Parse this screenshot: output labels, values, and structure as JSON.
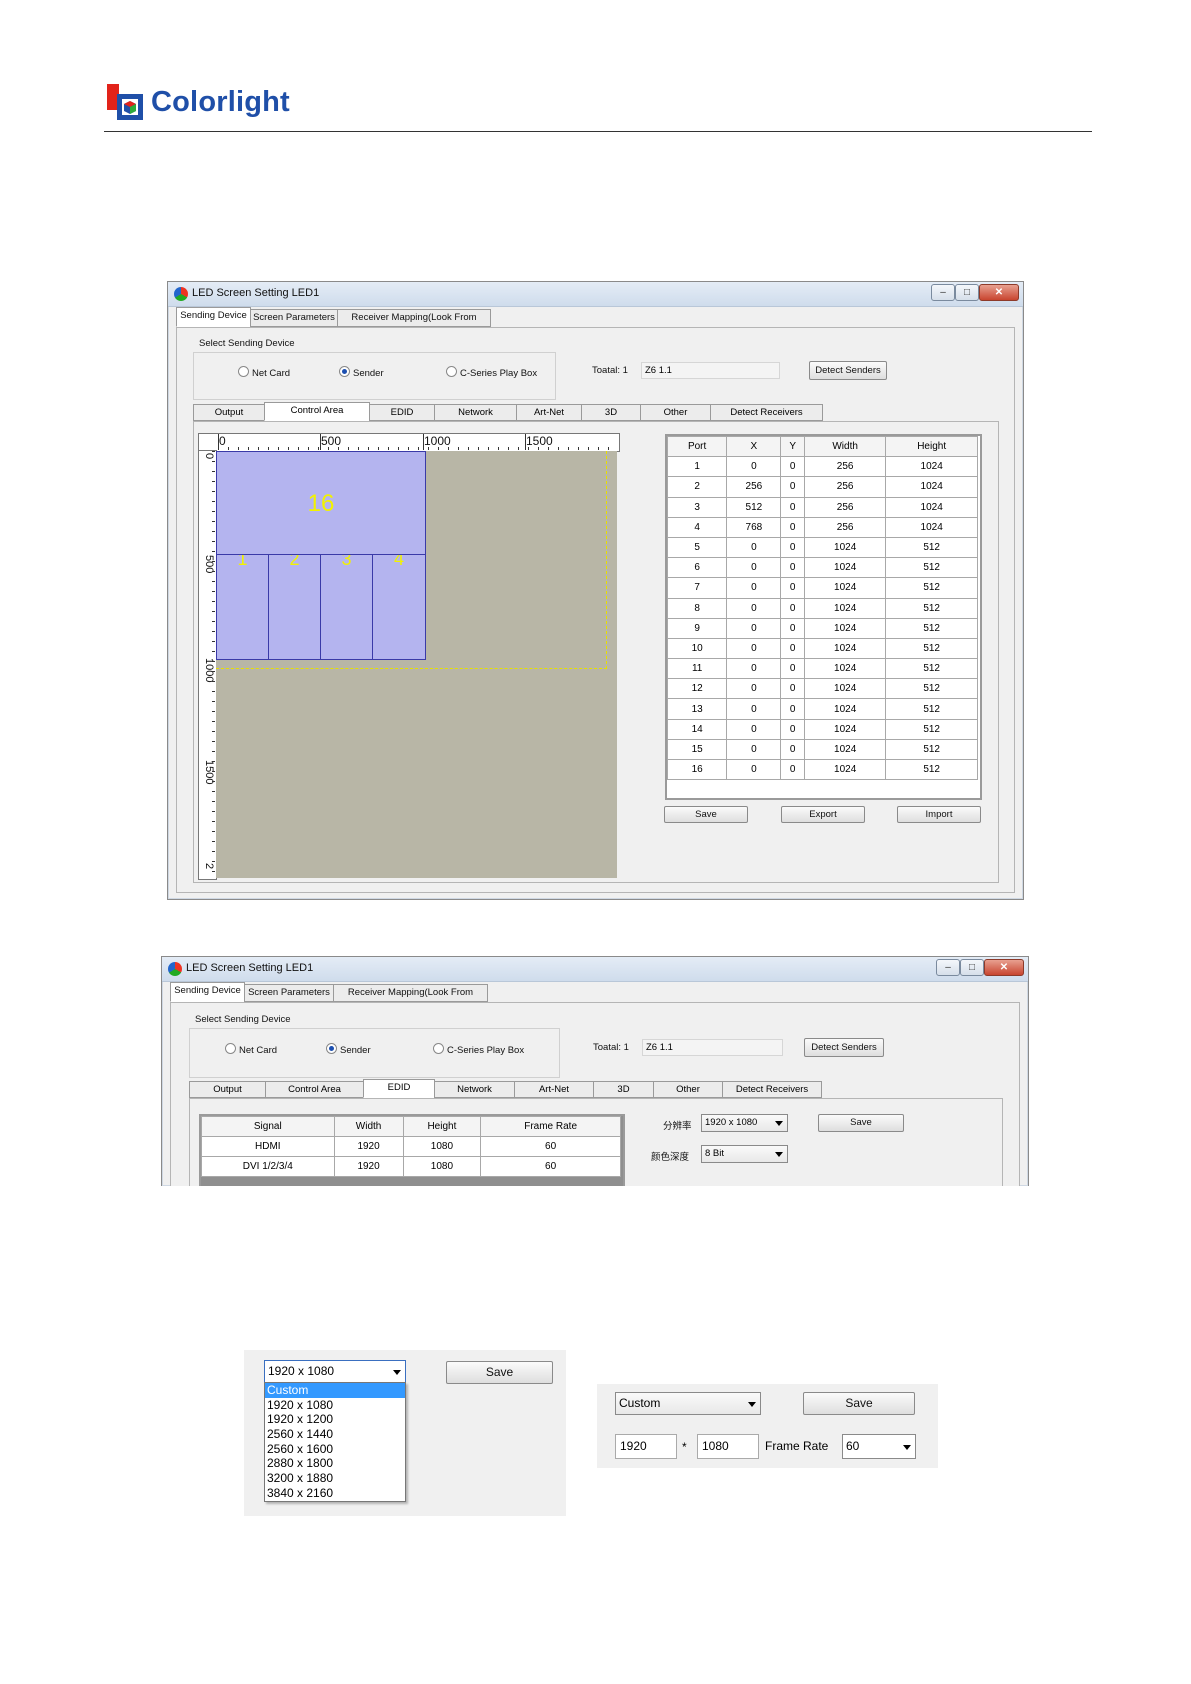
{
  "header": {
    "brand": "Colorlight"
  },
  "window1": {
    "title": "LED Screen Setting LED1",
    "tabs": [
      "Sending Device",
      "Screen Parameters",
      "Receiver Mapping(Look From Front)"
    ],
    "group_label": "Select Sending Device",
    "radios": [
      {
        "label": "Net Card",
        "selected": false
      },
      {
        "label": "Sender",
        "selected": true
      },
      {
        "label": "C-Series Play Box",
        "selected": false
      }
    ],
    "total_label": "Toatal: 1",
    "device_value": "Z6 1.1",
    "detect_senders": "Detect Senders",
    "subtabs": [
      "Output",
      "Control Area",
      "EDID",
      "Network",
      "Art-Net",
      "3D",
      "Other",
      "Detect Receivers"
    ],
    "active_subtab": "Control Area",
    "ruler_h": [
      "0",
      "500",
      "1000",
      "1500"
    ],
    "ruler_v": [
      "0",
      "500",
      "1000",
      "1500",
      "2"
    ],
    "modules": [
      "16",
      "1",
      "2",
      "3",
      "4"
    ],
    "port_table": {
      "headers": [
        "Port",
        "X",
        "Y",
        "Width",
        "Height"
      ],
      "rows": [
        [
          "1",
          "0",
          "0",
          "256",
          "1024"
        ],
        [
          "2",
          "256",
          "0",
          "256",
          "1024"
        ],
        [
          "3",
          "512",
          "0",
          "256",
          "1024"
        ],
        [
          "4",
          "768",
          "0",
          "256",
          "1024"
        ],
        [
          "5",
          "0",
          "0",
          "1024",
          "512"
        ],
        [
          "6",
          "0",
          "0",
          "1024",
          "512"
        ],
        [
          "7",
          "0",
          "0",
          "1024",
          "512"
        ],
        [
          "8",
          "0",
          "0",
          "1024",
          "512"
        ],
        [
          "9",
          "0",
          "0",
          "1024",
          "512"
        ],
        [
          "10",
          "0",
          "0",
          "1024",
          "512"
        ],
        [
          "11",
          "0",
          "0",
          "1024",
          "512"
        ],
        [
          "12",
          "0",
          "0",
          "1024",
          "512"
        ],
        [
          "13",
          "0",
          "0",
          "1024",
          "512"
        ],
        [
          "14",
          "0",
          "0",
          "1024",
          "512"
        ],
        [
          "15",
          "0",
          "0",
          "1024",
          "512"
        ],
        [
          "16",
          "0",
          "0",
          "1024",
          "512"
        ]
      ]
    },
    "buttons": [
      "Save",
      "Export",
      "Import"
    ]
  },
  "window2": {
    "title": "LED Screen Setting LED1",
    "tabs": [
      "Sending Device",
      "Screen Parameters",
      "Receiver Mapping(Look From Front)"
    ],
    "group_label": "Select Sending Device",
    "radios": [
      {
        "label": "Net Card",
        "selected": false
      },
      {
        "label": "Sender",
        "selected": true
      },
      {
        "label": "C-Series Play Box",
        "selected": false
      }
    ],
    "total_label": "Toatal: 1",
    "device_value": "Z6 1.1",
    "detect_senders": "Detect Senders",
    "subtabs": [
      "Output",
      "Control Area",
      "EDID",
      "Network",
      "Art-Net",
      "3D",
      "Other",
      "Detect Receivers"
    ],
    "active_subtab": "EDID",
    "edid_table": {
      "headers": [
        "Signal",
        "Width",
        "Height",
        "Frame Rate"
      ],
      "rows": [
        [
          "HDMI",
          "1920",
          "1080",
          "60"
        ],
        [
          "DVI 1/2/3/4",
          "1920",
          "1080",
          "60"
        ]
      ]
    },
    "resolution_label": "分辨率",
    "resolution_value": "1920 x 1080",
    "color_depth_label": "颜色深度",
    "color_depth_value": "8 Bit",
    "save": "Save"
  },
  "dropdown_panel": {
    "selected": "1920 x 1080",
    "save": "Save",
    "options": [
      "Custom",
      "1920 x 1080",
      "1920 x 1200",
      "2560 x 1440",
      "2560 x 1600",
      "2880 x 1800",
      "3200 x 1880",
      "3840 x 2160"
    ],
    "highlighted": "Custom"
  },
  "custom_panel": {
    "selected": "Custom",
    "save": "Save",
    "width": "1920",
    "times": "*",
    "height": "1080",
    "frame_rate_label": "Frame Rate",
    "frame_rate_value": "60"
  }
}
